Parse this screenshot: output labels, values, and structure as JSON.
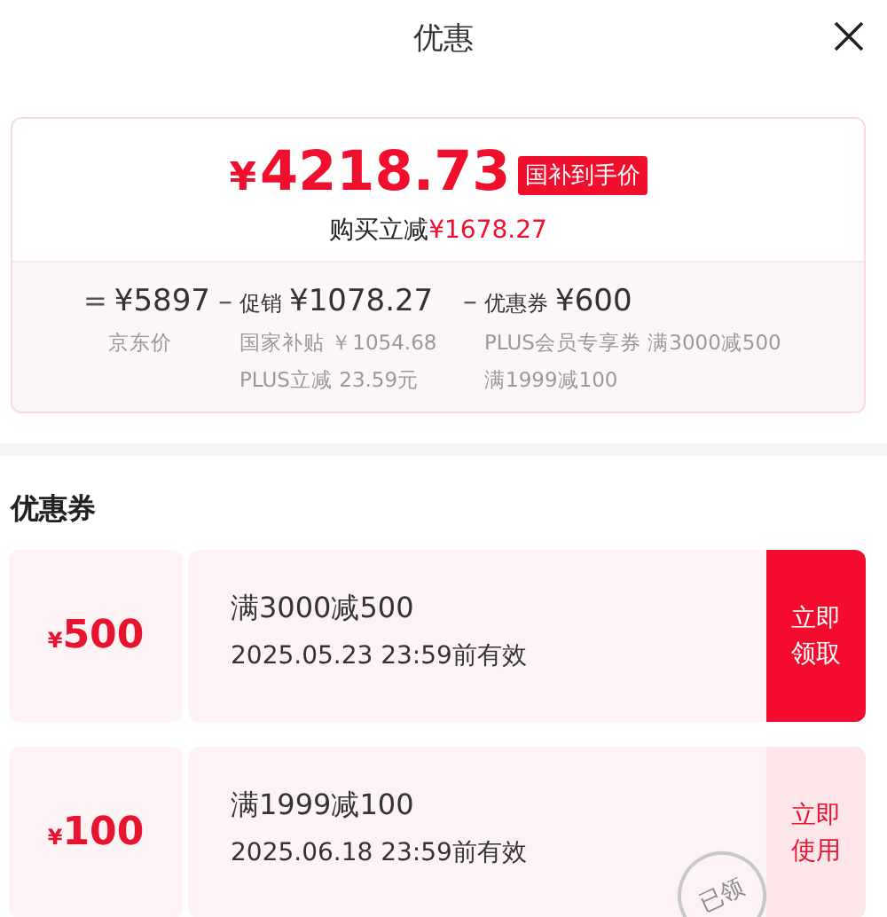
{
  "header": {
    "title": "优惠"
  },
  "price_card": {
    "currency": "¥",
    "amount": "4218.73",
    "badge": "国补到手价",
    "saving_label": "购买立减",
    "saving_amount": "¥1678.27",
    "breakdown": [
      {
        "sign": "=",
        "amount": "¥5897",
        "notes": [
          "京东价"
        ]
      },
      {
        "sign": "–",
        "name": "促销",
        "amount": "¥1078.27",
        "notes": [
          "国家补贴 ￥1054.68",
          "PLUS立减 23.59元"
        ]
      },
      {
        "sign": "–",
        "name": "优惠券",
        "amount": "¥600",
        "notes": [
          "PLUS会员专享券 满3000减500",
          "满1999减100"
        ]
      }
    ]
  },
  "coupons_section": {
    "title": "优惠券",
    "coupons": [
      {
        "currency": "¥",
        "amount": "500",
        "condition": "满3000减500",
        "validity": "2025.05.23 23:59前有效",
        "action": "立即领取",
        "claimed": false
      },
      {
        "currency": "¥",
        "amount": "100",
        "condition": "满1999减100",
        "validity": "2025.06.18 23:59前有效",
        "action": "立即使用",
        "claimed": true,
        "stamp": "已领"
      }
    ]
  }
}
